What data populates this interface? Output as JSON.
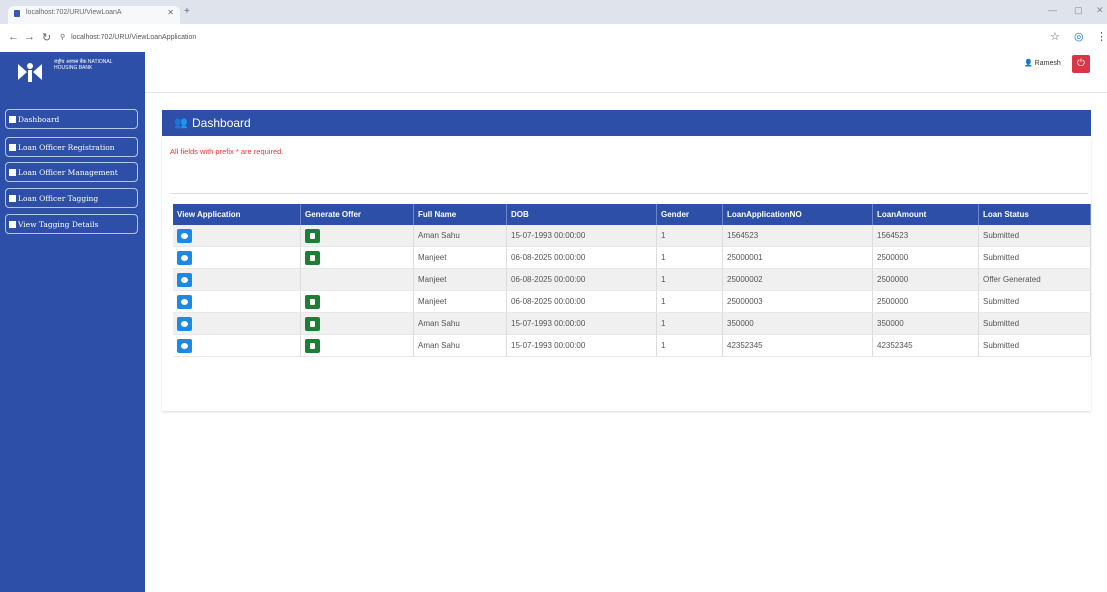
{
  "browser": {
    "tab_title": "localhost:702/URU/ViewLoanA",
    "url": "localhost:702/URU/ViewLoanApplication"
  },
  "app": {
    "logo_text": "राष्ट्रीय आवास बैंक NATIONAL HOUSING BANK",
    "user_name": "Ramesh",
    "brand_color": "#2d4fa8",
    "logout_color": "#dc3545"
  },
  "sidebar": {
    "items": [
      {
        "label": "Dashboard"
      },
      {
        "label": "Loan Officer Registration"
      },
      {
        "label": "Loan Officer Management"
      },
      {
        "label": "Loan Officer Tagging"
      },
      {
        "label": "View Tagging Details"
      }
    ]
  },
  "main": {
    "title": "Dashboard",
    "required_note": "All fields with prefix * are required.",
    "table": {
      "headers": [
        "View Application",
        "Generate Offer",
        "Full Name",
        "DOB",
        "Gender",
        "LoanApplicationNO",
        "LoanAmount",
        "Loan Status"
      ],
      "rows": [
        {
          "has_offer": true,
          "full_name": "Aman Sahu",
          "dob": "15-07-1993 00:00:00",
          "gender": "1",
          "app_no": "1564523",
          "amount": "1564523",
          "status": "Submitted"
        },
        {
          "has_offer": true,
          "full_name": "Manjeet",
          "dob": "06-08-2025 00:00:00",
          "gender": "1",
          "app_no": "25000001",
          "amount": "2500000",
          "status": "Submitted"
        },
        {
          "has_offer": false,
          "full_name": "Manjeet",
          "dob": "06-08-2025 00:00:00",
          "gender": "1",
          "app_no": "25000002",
          "amount": "2500000",
          "status": "Offer Generated"
        },
        {
          "has_offer": true,
          "full_name": "Manjeet",
          "dob": "06-08-2025 00:00:00",
          "gender": "1",
          "app_no": "25000003",
          "amount": "2500000",
          "status": "Submitted"
        },
        {
          "has_offer": true,
          "full_name": "Aman Sahu",
          "dob": "15-07-1993 00:00:00",
          "gender": "1",
          "app_no": "350000",
          "amount": "350000",
          "status": "Submitted"
        },
        {
          "has_offer": true,
          "full_name": "Aman Sahu",
          "dob": "15-07-1993 00:00:00",
          "gender": "1",
          "app_no": "42352345",
          "amount": "42352345",
          "status": "Submitted"
        }
      ]
    }
  }
}
